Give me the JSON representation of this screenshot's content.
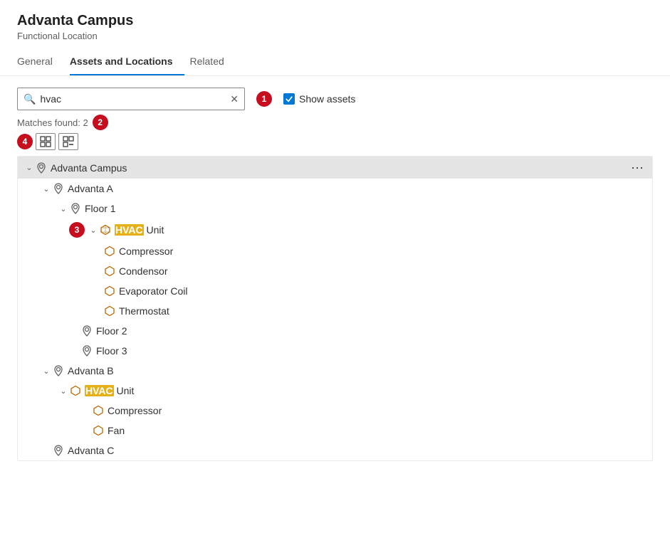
{
  "header": {
    "title": "Advanta Campus",
    "subtitle": "Functional Location"
  },
  "tabs": [
    {
      "id": "general",
      "label": "General",
      "active": false
    },
    {
      "id": "assets-locations",
      "label": "Assets and Locations",
      "active": true
    },
    {
      "id": "related",
      "label": "Related",
      "active": false
    }
  ],
  "search": {
    "value": "hvac",
    "placeholder": "Search",
    "matches_label": "Matches found: 2"
  },
  "show_assets": {
    "label": "Show assets",
    "checked": true
  },
  "badges": {
    "step1": "1",
    "step2": "2",
    "step3": "3",
    "step4": "4"
  },
  "toolbar": {
    "expand_all_title": "Expand all",
    "collapse_all_title": "Collapse all"
  },
  "tree": [
    {
      "id": "advanta-campus",
      "label": "Advanta Campus",
      "type": "location",
      "level": 0,
      "expanded": true,
      "has_more": true,
      "selected": true,
      "children": [
        {
          "id": "advanta-a",
          "label": "Advanta A",
          "type": "location",
          "level": 1,
          "expanded": true,
          "children": [
            {
              "id": "floor-1",
              "label": "Floor 1",
              "type": "location",
              "level": 2,
              "expanded": true,
              "children": [
                {
                  "id": "hvac-unit-1",
                  "label": "HVAC Unit",
                  "highlight": "HVAC",
                  "type": "asset",
                  "level": 3,
                  "expanded": true,
                  "children": [
                    {
                      "id": "compressor-1",
                      "label": "Compressor",
                      "type": "asset",
                      "level": 4
                    },
                    {
                      "id": "condensor-1",
                      "label": "Condensor",
                      "type": "asset",
                      "level": 4
                    },
                    {
                      "id": "evaporator-coil-1",
                      "label": "Evaporator Coil",
                      "type": "asset",
                      "level": 4
                    },
                    {
                      "id": "thermostat-1",
                      "label": "Thermostat",
                      "type": "asset",
                      "level": 4
                    }
                  ]
                }
              ]
            },
            {
              "id": "floor-2",
              "label": "Floor 2",
              "type": "location",
              "level": 2
            },
            {
              "id": "floor-3",
              "label": "Floor 3",
              "type": "location",
              "level": 2
            }
          ]
        },
        {
          "id": "advanta-b",
          "label": "Advanta B",
          "type": "location",
          "level": 1,
          "expanded": true,
          "children": [
            {
              "id": "hvac-unit-2",
              "label": "HVAC Unit",
              "highlight": "HVAC",
              "type": "asset",
              "level": 2,
              "expanded": true,
              "children": [
                {
                  "id": "compressor-2",
                  "label": "Compressor",
                  "type": "asset",
                  "level": 3
                },
                {
                  "id": "fan-1",
                  "label": "Fan",
                  "type": "asset",
                  "level": 3
                }
              ]
            }
          ]
        },
        {
          "id": "advanta-c",
          "label": "Advanta C",
          "type": "location",
          "level": 1
        }
      ]
    }
  ]
}
